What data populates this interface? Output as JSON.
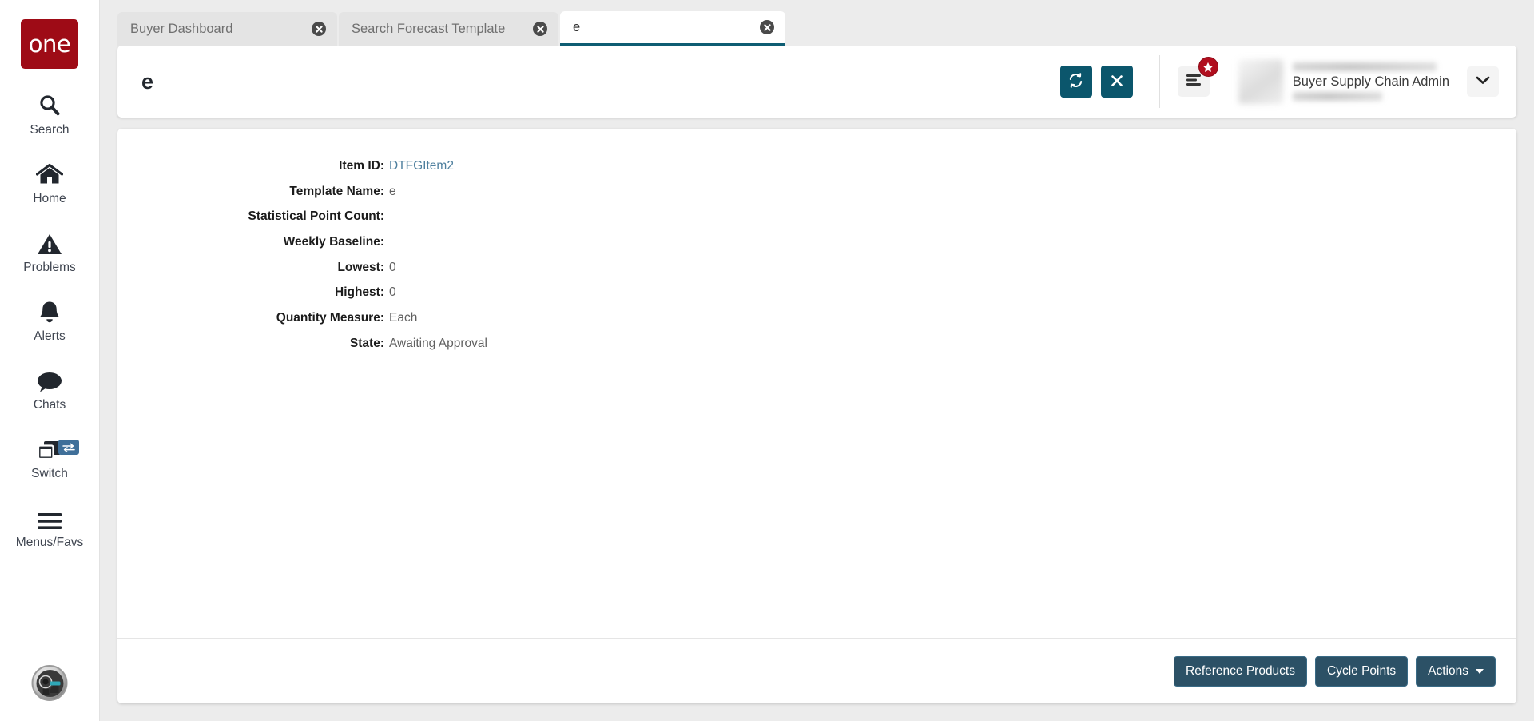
{
  "sidebar": {
    "logo_text": "one",
    "items": [
      {
        "label": "Search",
        "icon": "search-icon"
      },
      {
        "label": "Home",
        "icon": "home-icon"
      },
      {
        "label": "Problems",
        "icon": "warning-triangle-icon"
      },
      {
        "label": "Alerts",
        "icon": "bell-icon"
      },
      {
        "label": "Chats",
        "icon": "chat-bubble-icon"
      },
      {
        "label": "Switch",
        "icon": "windows-stack-icon",
        "badge_icon": "swap-arrows-icon"
      },
      {
        "label": "Menus/Favs",
        "icon": "hamburger-icon"
      }
    ],
    "assistant_icon": "ai-assistant-avatar-icon"
  },
  "tabs": [
    {
      "title": "Buyer Dashboard",
      "active": false
    },
    {
      "title": "Search Forecast Template",
      "active": false
    },
    {
      "title": "e",
      "active": true
    }
  ],
  "header": {
    "title": "e",
    "refresh_icon": "refresh-icon",
    "close_icon": "close-x-icon",
    "menu_icon": "list-menu-icon",
    "badge_icon": "star-icon",
    "profile_role": "Buyer Supply Chain Admin",
    "chevron_icon": "chevron-down-icon"
  },
  "detail": {
    "fields": [
      {
        "label": "Item ID:",
        "value": "DTFGItem2",
        "link": true
      },
      {
        "label": "Template Name:",
        "value": "e",
        "link": false
      },
      {
        "label": "Statistical Point Count:",
        "value": "",
        "link": false
      },
      {
        "label": "Weekly Baseline:",
        "value": "",
        "link": false
      },
      {
        "label": "Lowest:",
        "value": "0",
        "link": false
      },
      {
        "label": "Highest:",
        "value": "0",
        "link": false
      },
      {
        "label": "Quantity Measure:",
        "value": "Each",
        "link": false
      },
      {
        "label": "State:",
        "value": "Awaiting Approval",
        "link": false
      }
    ]
  },
  "footer": {
    "buttons": [
      {
        "label": "Reference Products",
        "caret": false
      },
      {
        "label": "Cycle Points",
        "caret": false
      },
      {
        "label": "Actions",
        "caret": true
      }
    ]
  },
  "colors": {
    "brand_red": "#9e0b16",
    "teal_button": "#0b566c",
    "navy_button": "#2c5166",
    "active_tab_underline": "#0e5d73",
    "link": "#4e7f9e",
    "badge_red": "#b10e1e"
  }
}
